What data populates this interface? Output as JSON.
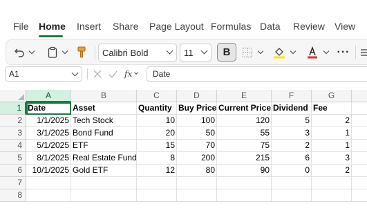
{
  "ribbon": {
    "tabs": [
      "File",
      "Home",
      "Insert",
      "Share",
      "Page Layout",
      "Formulas",
      "Data",
      "Review",
      "View"
    ],
    "active_tab": "Home"
  },
  "toolbar": {
    "font_name": "Calibri Bold",
    "font_size": "11",
    "bold_label": "B",
    "accent_color": "#1a7a43",
    "highlight_color": "#ffe400",
    "font_color": "#d13438"
  },
  "formula_bar": {
    "name_box": "A1",
    "fx_label": "fx",
    "formula": "Date"
  },
  "sheet": {
    "columns": [
      "A",
      "B",
      "C",
      "D",
      "E",
      "F",
      "G"
    ],
    "rows": [
      "1",
      "2",
      "3",
      "4",
      "5",
      "6",
      "7",
      "8"
    ],
    "headers": [
      "Date",
      "Asset",
      "Quantity",
      "Buy Price",
      "Current Price",
      "Dividend",
      "Fee"
    ],
    "data": [
      [
        "1/1/2025",
        "Tech Stock",
        "10",
        "100",
        "120",
        "5",
        "2"
      ],
      [
        "3/1/2025",
        "Bond Fund",
        "20",
        "50",
        "55",
        "3",
        "1"
      ],
      [
        "5/1/2025",
        "ETF",
        "15",
        "70",
        "75",
        "2",
        "1"
      ],
      [
        "8/1/2025",
        "Real Estate Fund",
        "8",
        "200",
        "215",
        "6",
        "3"
      ],
      [
        "10/1/2025",
        "Gold ETF",
        "12",
        "80",
        "90",
        "0",
        "2"
      ]
    ]
  }
}
